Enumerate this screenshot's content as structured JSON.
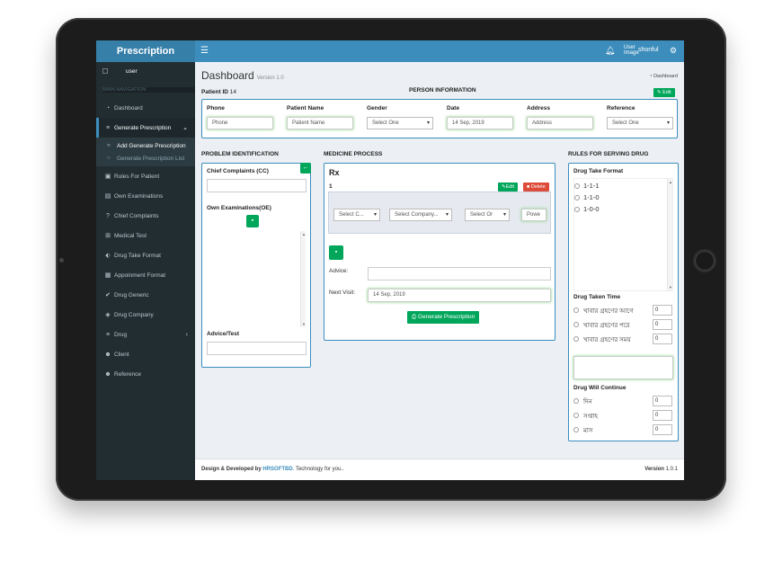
{
  "app": {
    "title": "Prescription"
  },
  "header": {
    "menu_icon": "hamburger-icon",
    "bell_icon": "bell-icon",
    "user_image_alt": "User Image",
    "user_name": "shonful",
    "settings_icon": "cogs-icon"
  },
  "sidebar": {
    "user_image_alt": "user",
    "nav_header": "MAIN NAVIGATION",
    "items": [
      {
        "label": "Dashboard",
        "icon": "dashboard-icon"
      },
      {
        "label": "Generate Prescription",
        "icon": "list-icon"
      },
      {
        "label": "Rules For Patient",
        "icon": "briefcase-icon"
      },
      {
        "label": "Own Examinations",
        "icon": "file-icon"
      },
      {
        "label": "Chief Complaints",
        "icon": "question-icon"
      },
      {
        "label": "Medical Test",
        "icon": "plus-square-icon"
      },
      {
        "label": "Drug Take Format",
        "icon": "tags-icon"
      },
      {
        "label": "Appoinment Format",
        "icon": "calendar-icon"
      },
      {
        "label": "Drug Generic",
        "icon": "check-circle-icon"
      },
      {
        "label": "Drug Company",
        "icon": "shield-icon"
      },
      {
        "label": "Drug",
        "icon": "list-icon"
      },
      {
        "label": "Client",
        "icon": "users-icon"
      },
      {
        "label": "Reference",
        "icon": "users-icon"
      }
    ],
    "sub_items": [
      {
        "label": "Add Generate Prescription"
      },
      {
        "label": "Generate Prescription List"
      }
    ]
  },
  "page": {
    "title": "Dashboard",
    "version_tag": "Version 1.0",
    "breadcrumb": "Dashboard"
  },
  "person": {
    "patient_id_label": "Patient ID",
    "patient_id": "14",
    "section_title": "PERSON INFORMATION",
    "edit_label": "Edit",
    "fields": [
      {
        "label": "Phone",
        "value": "Phone"
      },
      {
        "label": "Patient Name",
        "value": "Patient Name"
      },
      {
        "label": "Gender",
        "value": "Select One"
      },
      {
        "label": "Date",
        "value": "14 Sep, 2019"
      },
      {
        "label": "Address",
        "value": "Address"
      },
      {
        "label": "Reference",
        "value": "Select One"
      }
    ]
  },
  "problem": {
    "section_title": "PROBLEM IDENTIFICATION",
    "cc_label": "Chief Complaints (CC)",
    "oe_label": "Own Examinations(OE)",
    "advice_label": "Advice/Test"
  },
  "medicine": {
    "section_title": "MEDICINE PROCESS",
    "rx": "Rx",
    "row_number": "1",
    "edit_label": "Edit",
    "delete_label": "Delete",
    "select_company_short": "Select C...",
    "select_company": "Select Company...",
    "select_or": "Select Or",
    "power": "Powe",
    "advice_label": "Advice:",
    "next_visit_label": "Next Visit:",
    "next_visit_value": "14 Sep, 2019",
    "generate_label": "Generate Prescription"
  },
  "rules": {
    "section_title": "RULES FOR SERVING DRUG",
    "take_format_label": "Drug Take Format",
    "formats": [
      "1-1-1",
      "1-1-0",
      "1-0-0"
    ],
    "taken_time_label": "Drug Taken Time",
    "times": [
      {
        "label": "খাবার গ্রহণের আগে",
        "value": "0"
      },
      {
        "label": "খাবার গ্রহণের পরে",
        "value": "0"
      },
      {
        "label": "খাবার গ্রহণের সময়",
        "value": "0"
      }
    ],
    "continue_label": "Drug Will Continue",
    "continue": [
      {
        "label": "দিন",
        "value": "0"
      },
      {
        "label": "সপ্তাহ",
        "value": "0"
      },
      {
        "label": "মাস",
        "value": "0"
      }
    ]
  },
  "footer": {
    "design_text": "Design & Developed by",
    "company": "HRSOFTBD",
    "tagline": "Technology for you..",
    "version_label": "Version",
    "version": "1.0.1"
  },
  "colors": {
    "primary": "#3c8dbc",
    "sidebar": "#222d32",
    "success": "#00a65a",
    "danger": "#dd4b39"
  }
}
